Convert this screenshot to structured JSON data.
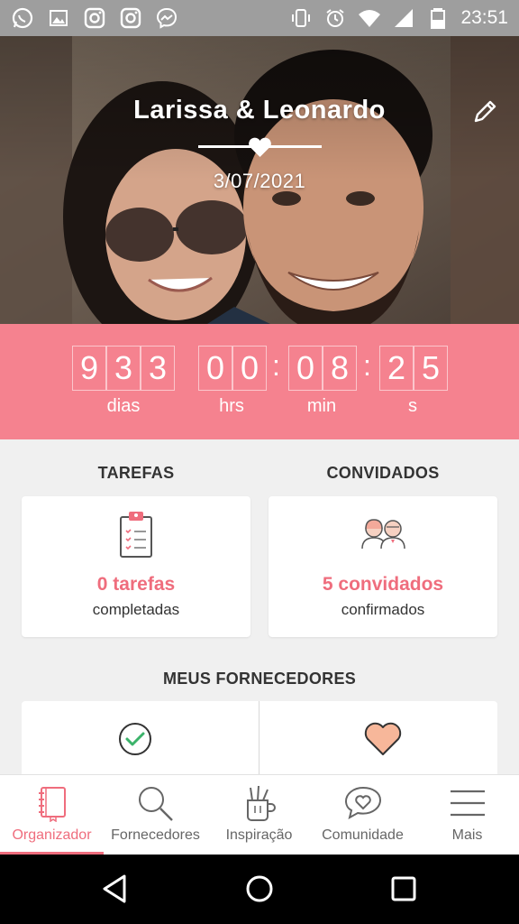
{
  "status_bar": {
    "time": "23:51",
    "icons_left": [
      "whatsapp-icon",
      "gallery-icon",
      "instagram-icon",
      "instagram-icon",
      "messenger-icon"
    ],
    "icons_right": [
      "vibrate-icon",
      "alarm-icon",
      "wifi-icon",
      "signal-icon",
      "battery-icon"
    ]
  },
  "hero": {
    "couple_names": "Larissa & Leonardo",
    "wedding_date": "3/07/2021"
  },
  "countdown": {
    "days_digits": [
      "9",
      "3",
      "3"
    ],
    "hours_digits": [
      "0",
      "0"
    ],
    "minutes_digits": [
      "0",
      "8"
    ],
    "seconds_digits": [
      "2",
      "5"
    ],
    "separator": ":",
    "units": {
      "days": "dias",
      "hours": "hrs",
      "minutes": "min",
      "seconds": "s"
    }
  },
  "tasks": {
    "title": "TAREFAS",
    "count_label": "0 tarefas",
    "sub_label": "completadas"
  },
  "guests": {
    "title": "CONVIDADOS",
    "count_label": "5 convidados",
    "sub_label": "confirmados"
  },
  "suppliers": {
    "title": "MEUS FORNECEDORES"
  },
  "bottom_nav": {
    "items": [
      {
        "label": "Organizador",
        "icon": "notebook-icon",
        "active": true
      },
      {
        "label": "Fornecedores",
        "icon": "search-icon",
        "active": false
      },
      {
        "label": "Inspiração",
        "icon": "brushes-icon",
        "active": false
      },
      {
        "label": "Comunidade",
        "icon": "chat-heart-icon",
        "active": false
      },
      {
        "label": "Mais",
        "icon": "menu-icon",
        "active": false
      }
    ]
  },
  "colors": {
    "accent": "#ef6d7d",
    "countdown_bg": "#f5828f",
    "status_bar_bg": "#9e9e9e"
  }
}
